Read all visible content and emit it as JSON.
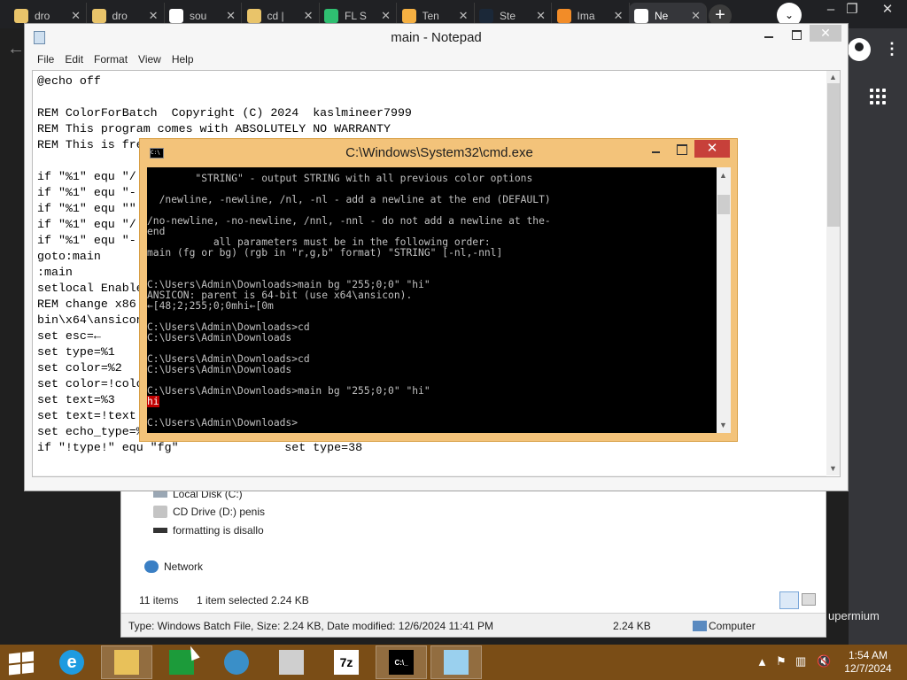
{
  "browser": {
    "tabs": [
      {
        "label": "dro",
        "icon": "folder-icon"
      },
      {
        "label": "dro",
        "icon": "folder-icon"
      },
      {
        "label": "sou",
        "icon": "google-icon"
      },
      {
        "label": "cd |",
        "icon": "folder-icon"
      },
      {
        "label": "FL S",
        "icon": "play-store-icon"
      },
      {
        "label": "Ten",
        "icon": "home-icon"
      },
      {
        "label": "Ste",
        "icon": "steam-icon"
      },
      {
        "label": "Ima",
        "icon": "fl-studio-icon"
      },
      {
        "label": "Ne",
        "icon": "chrome-icon"
      }
    ],
    "new_tab_label": "+",
    "side_label": "upermium"
  },
  "notepad": {
    "title": "main - Notepad",
    "menu": [
      "File",
      "Edit",
      "Format",
      "View",
      "Help"
    ],
    "lines": [
      "@echo off",
      "",
      "REM ColorForBatch  Copyright (C) 2024  kaslmineer7999",
      "REM This program comes with ABSOLUTELY NO WARRANTY",
      "REM This is fre",
      "",
      "if \"%1\" equ \"/",
      "if \"%1\" equ \"-",
      "if \"%1\" equ \"\"",
      "if \"%1\" equ \"/",
      "if \"%1\" equ \"-",
      "goto:main",
      ":main",
      "setlocal Enable",
      "REM change x86",
      "bin\\x64\\ansicon",
      "set esc=←",
      "set type=%1",
      "set color=%2",
      "set color=!colo",
      "set text=%3",
      "set text=!text",
      "set echo_type=%",
      "if \"!type!\" equ \"fg\"               set type=38"
    ]
  },
  "cmd": {
    "title": "C:\\Windows\\System32\\cmd.exe",
    "lines": [
      "        \"STRING\" - output STRING with all previous color options",
      "",
      "  /newline, -newline, /nl, -nl - add a newline at the end (DEFAULT)",
      "",
      "/no-newline, -no-newline, /nnl, -nnl - do not add a newline at the-",
      "end",
      "           all parameters must be in the following order:",
      "main (fg or bg) (rgb in \"r,g,b\" format) \"STRING\" [-nl,-nnl]",
      "",
      "",
      "C:\\Users\\Admin\\Downloads>main bg \"255;0;0\" \"hi\"",
      "ANSICON: parent is 64-bit (use x64\\ansicon).",
      "←[48;2;255;0;0mhi←[0m",
      "",
      "C:\\Users\\Admin\\Downloads>cd",
      "C:\\Users\\Admin\\Downloads",
      "",
      "C:\\Users\\Admin\\Downloads>cd",
      "C:\\Users\\Admin\\Downloads",
      "",
      "C:\\Users\\Admin\\Downloads>main bg \"255;0;0\" \"hi\"",
      "hi",
      "",
      "C:\\Users\\Admin\\Downloads>"
    ],
    "highlight_color": "#c00000"
  },
  "explorer": {
    "drives": [
      {
        "label": "Local Disk (C:)",
        "icon": "hard-drive-icon"
      },
      {
        "label": "CD Drive (D:) penis",
        "icon": "cd-drive-icon"
      },
      {
        "label": "formatting is disallo",
        "icon": "usb-drive-icon"
      }
    ],
    "network_label": "Network",
    "item_count": "11 items",
    "selection": "1 item selected  2.24 KB",
    "status_info": "Type: Windows Batch File, Size: 2.24 KB, Date modified: 12/6/2024 11:41 PM",
    "status_size": "2.24 KB",
    "status_location": "Computer"
  },
  "taskbar": {
    "apps": [
      {
        "name": "internet-explorer-icon",
        "glyph": "e",
        "color": "#1e9be0"
      },
      {
        "name": "file-explorer-icon",
        "glyph": "",
        "color": "#e8c15a"
      },
      {
        "name": "store-icon",
        "glyph": "",
        "color": "#1c9b3a"
      },
      {
        "name": "globe-app-icon",
        "glyph": "",
        "color": "#3a8fc8"
      },
      {
        "name": "paint-icon",
        "glyph": "",
        "color": "#cfcfcf"
      },
      {
        "name": "7zip-icon",
        "glyph": "7z",
        "color": "#ffffff"
      },
      {
        "name": "cmd-icon",
        "glyph": "C:\\_",
        "color": "#000000"
      },
      {
        "name": "notepad-icon",
        "glyph": "",
        "color": "#9ad0ee"
      }
    ],
    "time": "1:54 AM",
    "date": "12/7/2024",
    "accent": "#7a4d16"
  }
}
